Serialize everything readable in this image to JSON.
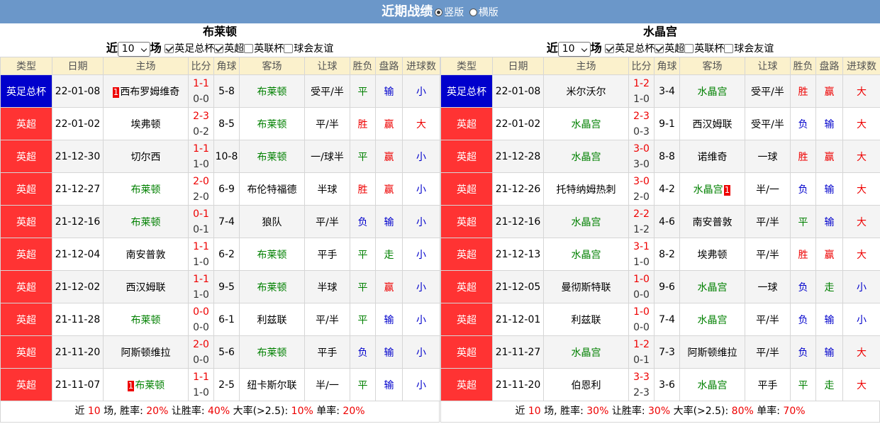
{
  "page": {
    "title": "近期战绩",
    "layout_options": [
      "竖版",
      "横版"
    ],
    "selected_layout": "竖版"
  },
  "columns": [
    "类型",
    "日期",
    "主场",
    "比分",
    "角球",
    "客场",
    "让球",
    "胜负",
    "盘路",
    "进球数"
  ],
  "colors": {
    "league_cup": "#0000cc",
    "league_epl": "#ff3333",
    "header_bg": "#6b97c9"
  },
  "panels": [
    {
      "team": "布莱顿",
      "prefix": "近",
      "count": "10",
      "suffix": "场",
      "filters": [
        {
          "label": "英足总杯",
          "checked": true
        },
        {
          "label": "英超",
          "checked": true
        },
        {
          "label": "英联杯",
          "checked": false
        },
        {
          "label": "球会友谊",
          "checked": false
        }
      ],
      "rows": [
        {
          "league": "英足总杯",
          "league_type": "cup",
          "date": "22-01-08",
          "home": "西布罗姆维奇",
          "home_card": "1",
          "home_green": false,
          "ft": "1-1",
          "ht": "0-0",
          "corners": "5-8",
          "away": "布莱顿",
          "away_card": "",
          "away_green": true,
          "handicap": "受平/半",
          "result": "平",
          "result_c": "green",
          "cover": "输",
          "cover_c": "blue",
          "goals": "小",
          "goals_c": "blue"
        },
        {
          "league": "英超",
          "league_type": "epl",
          "date": "22-01-02",
          "home": "埃弗顿",
          "home_card": "",
          "home_green": false,
          "ft": "2-3",
          "ht": "0-2",
          "corners": "8-5",
          "away": "布莱顿",
          "away_card": "",
          "away_green": true,
          "handicap": "平/半",
          "result": "胜",
          "result_c": "red",
          "cover": "赢",
          "cover_c": "red",
          "goals": "大",
          "goals_c": "red"
        },
        {
          "league": "英超",
          "league_type": "epl",
          "date": "21-12-30",
          "home": "切尔西",
          "home_card": "",
          "home_green": false,
          "ft": "1-1",
          "ht": "1-0",
          "corners": "10-8",
          "away": "布莱顿",
          "away_card": "",
          "away_green": true,
          "handicap": "一/球半",
          "result": "平",
          "result_c": "green",
          "cover": "赢",
          "cover_c": "red",
          "goals": "小",
          "goals_c": "blue"
        },
        {
          "league": "英超",
          "league_type": "epl",
          "date": "21-12-27",
          "home": "布莱顿",
          "home_card": "",
          "home_green": true,
          "ft": "2-0",
          "ht": "2-0",
          "corners": "6-9",
          "away": "布伦特福德",
          "away_card": "",
          "away_green": false,
          "handicap": "半球",
          "result": "胜",
          "result_c": "red",
          "cover": "赢",
          "cover_c": "red",
          "goals": "小",
          "goals_c": "blue"
        },
        {
          "league": "英超",
          "league_type": "epl",
          "date": "21-12-16",
          "home": "布莱顿",
          "home_card": "",
          "home_green": true,
          "ft": "0-1",
          "ht": "0-1",
          "corners": "7-4",
          "away": "狼队",
          "away_card": "",
          "away_green": false,
          "handicap": "平/半",
          "result": "负",
          "result_c": "blue",
          "cover": "输",
          "cover_c": "blue",
          "goals": "小",
          "goals_c": "blue"
        },
        {
          "league": "英超",
          "league_type": "epl",
          "date": "21-12-04",
          "home": "南安普敦",
          "home_card": "",
          "home_green": false,
          "ft": "1-1",
          "ht": "1-0",
          "corners": "6-2",
          "away": "布莱顿",
          "away_card": "",
          "away_green": true,
          "handicap": "平手",
          "result": "平",
          "result_c": "green",
          "cover": "走",
          "cover_c": "green",
          "goals": "小",
          "goals_c": "blue"
        },
        {
          "league": "英超",
          "league_type": "epl",
          "date": "21-12-02",
          "home": "西汉姆联",
          "home_card": "",
          "home_green": false,
          "ft": "1-1",
          "ht": "1-0",
          "corners": "9-5",
          "away": "布莱顿",
          "away_card": "",
          "away_green": true,
          "handicap": "半球",
          "result": "平",
          "result_c": "green",
          "cover": "赢",
          "cover_c": "red",
          "goals": "小",
          "goals_c": "blue"
        },
        {
          "league": "英超",
          "league_type": "epl",
          "date": "21-11-28",
          "home": "布莱顿",
          "home_card": "",
          "home_green": true,
          "ft": "0-0",
          "ht": "0-0",
          "corners": "6-1",
          "away": "利兹联",
          "away_card": "",
          "away_green": false,
          "handicap": "平/半",
          "result": "平",
          "result_c": "green",
          "cover": "输",
          "cover_c": "blue",
          "goals": "小",
          "goals_c": "blue"
        },
        {
          "league": "英超",
          "league_type": "epl",
          "date": "21-11-20",
          "home": "阿斯顿维拉",
          "home_card": "",
          "home_green": false,
          "ft": "2-0",
          "ht": "0-0",
          "corners": "5-6",
          "away": "布莱顿",
          "away_card": "",
          "away_green": true,
          "handicap": "平手",
          "result": "负",
          "result_c": "blue",
          "cover": "输",
          "cover_c": "blue",
          "goals": "小",
          "goals_c": "blue"
        },
        {
          "league": "英超",
          "league_type": "epl",
          "date": "21-11-07",
          "home": "布莱顿",
          "home_card": "1",
          "home_green": true,
          "ft": "1-1",
          "ht": "1-0",
          "corners": "2-5",
          "away": "纽卡斯尔联",
          "away_card": "",
          "away_green": false,
          "handicap": "半/一",
          "result": "平",
          "result_c": "green",
          "cover": "输",
          "cover_c": "blue",
          "goals": "小",
          "goals_c": "blue"
        }
      ],
      "summary": {
        "lead": "近",
        "n": "10",
        "l1": "场, 胜率:",
        "win": "20%",
        "l2": "让胜率:",
        "hcap": "40%",
        "l3": "大率(>2.5):",
        "over": "10%",
        "l4": "单率:",
        "odd": "20%"
      }
    },
    {
      "team": "水晶宫",
      "prefix": "近",
      "count": "10",
      "suffix": "场",
      "filters": [
        {
          "label": "英足总杯",
          "checked": true
        },
        {
          "label": "英超",
          "checked": true
        },
        {
          "label": "英联杯",
          "checked": false
        },
        {
          "label": "球会友谊",
          "checked": false
        }
      ],
      "rows": [
        {
          "league": "英足总杯",
          "league_type": "cup",
          "date": "22-01-08",
          "home": "米尔沃尔",
          "home_card": "",
          "home_green": false,
          "ft": "1-2",
          "ht": "1-0",
          "corners": "3-4",
          "away": "水晶宫",
          "away_card": "",
          "away_green": true,
          "handicap": "受平/半",
          "result": "胜",
          "result_c": "red",
          "cover": "赢",
          "cover_c": "red",
          "goals": "大",
          "goals_c": "red"
        },
        {
          "league": "英超",
          "league_type": "epl",
          "date": "22-01-02",
          "home": "水晶宫",
          "home_card": "",
          "home_green": true,
          "ft": "2-3",
          "ht": "0-3",
          "corners": "9-1",
          "away": "西汉姆联",
          "away_card": "",
          "away_green": false,
          "handicap": "受平/半",
          "result": "负",
          "result_c": "blue",
          "cover": "输",
          "cover_c": "blue",
          "goals": "大",
          "goals_c": "red"
        },
        {
          "league": "英超",
          "league_type": "epl",
          "date": "21-12-28",
          "home": "水晶宫",
          "home_card": "",
          "home_green": true,
          "ft": "3-0",
          "ht": "3-0",
          "corners": "8-8",
          "away": "诺维奇",
          "away_card": "",
          "away_green": false,
          "handicap": "一球",
          "result": "胜",
          "result_c": "red",
          "cover": "赢",
          "cover_c": "red",
          "goals": "大",
          "goals_c": "red"
        },
        {
          "league": "英超",
          "league_type": "epl",
          "date": "21-12-26",
          "home": "托特纳姆热刺",
          "home_card": "",
          "home_green": false,
          "ft": "3-0",
          "ht": "2-0",
          "corners": "4-2",
          "away": "水晶宫",
          "away_card": "1",
          "away_green": true,
          "handicap": "半/一",
          "result": "负",
          "result_c": "blue",
          "cover": "输",
          "cover_c": "blue",
          "goals": "大",
          "goals_c": "red"
        },
        {
          "league": "英超",
          "league_type": "epl",
          "date": "21-12-16",
          "home": "水晶宫",
          "home_card": "",
          "home_green": true,
          "ft": "2-2",
          "ht": "1-2",
          "corners": "4-6",
          "away": "南安普敦",
          "away_card": "",
          "away_green": false,
          "handicap": "平/半",
          "result": "平",
          "result_c": "green",
          "cover": "输",
          "cover_c": "blue",
          "goals": "大",
          "goals_c": "red"
        },
        {
          "league": "英超",
          "league_type": "epl",
          "date": "21-12-13",
          "home": "水晶宫",
          "home_card": "",
          "home_green": true,
          "ft": "3-1",
          "ht": "1-0",
          "corners": "8-2",
          "away": "埃弗顿",
          "away_card": "",
          "away_green": false,
          "handicap": "平/半",
          "result": "胜",
          "result_c": "red",
          "cover": "赢",
          "cover_c": "red",
          "goals": "大",
          "goals_c": "red"
        },
        {
          "league": "英超",
          "league_type": "epl",
          "date": "21-12-05",
          "home": "曼彻斯特联",
          "home_card": "",
          "home_green": false,
          "ft": "1-0",
          "ht": "0-0",
          "corners": "9-6",
          "away": "水晶宫",
          "away_card": "",
          "away_green": true,
          "handicap": "一球",
          "result": "负",
          "result_c": "blue",
          "cover": "走",
          "cover_c": "green",
          "goals": "小",
          "goals_c": "blue"
        },
        {
          "league": "英超",
          "league_type": "epl",
          "date": "21-12-01",
          "home": "利兹联",
          "home_card": "",
          "home_green": false,
          "ft": "1-0",
          "ht": "0-0",
          "corners": "7-4",
          "away": "水晶宫",
          "away_card": "",
          "away_green": true,
          "handicap": "平/半",
          "result": "负",
          "result_c": "blue",
          "cover": "输",
          "cover_c": "blue",
          "goals": "小",
          "goals_c": "blue"
        },
        {
          "league": "英超",
          "league_type": "epl",
          "date": "21-11-27",
          "home": "水晶宫",
          "home_card": "",
          "home_green": true,
          "ft": "1-2",
          "ht": "0-1",
          "corners": "7-3",
          "away": "阿斯顿维拉",
          "away_card": "",
          "away_green": false,
          "handicap": "平/半",
          "result": "负",
          "result_c": "blue",
          "cover": "输",
          "cover_c": "blue",
          "goals": "大",
          "goals_c": "red"
        },
        {
          "league": "英超",
          "league_type": "epl",
          "date": "21-11-20",
          "home": "伯恩利",
          "home_card": "",
          "home_green": false,
          "ft": "3-3",
          "ht": "2-3",
          "corners": "3-6",
          "away": "水晶宫",
          "away_card": "",
          "away_green": true,
          "handicap": "平手",
          "result": "平",
          "result_c": "green",
          "cover": "走",
          "cover_c": "green",
          "goals": "大",
          "goals_c": "red"
        }
      ],
      "summary": {
        "lead": "近",
        "n": "10",
        "l1": "场, 胜率:",
        "win": "30%",
        "l2": "让胜率:",
        "hcap": "30%",
        "l3": "大率(>2.5):",
        "over": "80%",
        "l4": "单率:",
        "odd": "70%"
      }
    }
  ]
}
